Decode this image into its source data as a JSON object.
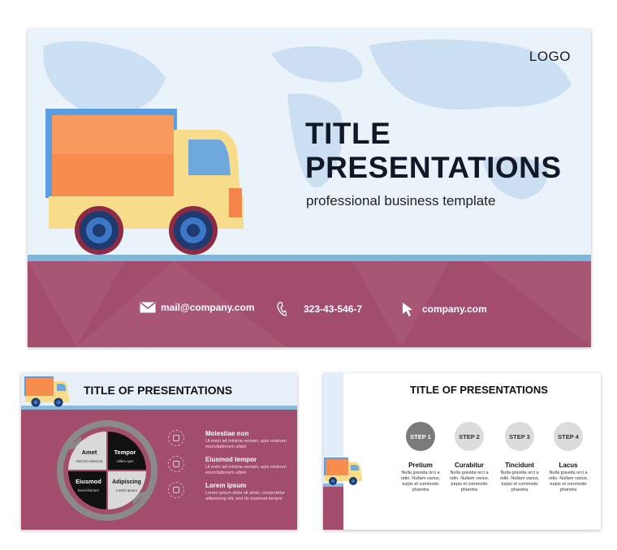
{
  "colors": {
    "band": "#a34d6c",
    "sky": "#eaf2fa",
    "strip": "#7fb6dc",
    "truck_cargo": "#f68c4d",
    "truck_cab": "#f7dc8c",
    "truck_window": "#6fa8dc",
    "wheel": "#1e3a6e"
  },
  "main_slide": {
    "logo": "LOGO",
    "title_line1": "TITLE",
    "title_line2": "PRESENTATIONS",
    "subtitle": "professional business template",
    "contacts": {
      "email": "mail@company.com",
      "phone": "323-43-546-7",
      "website": "company.com"
    }
  },
  "slide_cycle": {
    "title": "TITLE OF PRESENTATIONS",
    "cycle": [
      {
        "label": "Amet",
        "sub": "Sed do eiusmod"
      },
      {
        "label": "Tempor",
        "sub": "Ullam quis"
      },
      {
        "label": "Adipiscing",
        "sub": "Lorem ipsum"
      },
      {
        "label": "Eiusmod",
        "sub": "Exercitionem"
      }
    ],
    "items": [
      {
        "heading": "Molestiae non",
        "body": "Ut enim ad minima veniam, quis nostrum exercitationem ullam"
      },
      {
        "heading": "Eiusmod tempor",
        "body": "Ut enim ad minima veniam, quis nostrum exercitationem ullam"
      },
      {
        "heading": "Lorem ipsum",
        "body": "Lorem ipsum dolor sit amet, consectetur adipisicing elit, sed do eiusmod tempor"
      }
    ]
  },
  "slide_steps": {
    "title": "TITLE OF PRESENTATIONS",
    "steps": [
      {
        "label": "STEP 1",
        "name": "Pretium",
        "desc": "Nulla gravida orci a odio. Nullam varius, turpis et commodo pharetra"
      },
      {
        "label": "STEP 2",
        "name": "Curabitur",
        "desc": "Nulla gravida orci a odio. Nullam varius, turpis et commodo pharetra"
      },
      {
        "label": "STEP 3",
        "name": "Tincidunt",
        "desc": "Nulla gravida orci a odio. Nullam varius, turpis et commodo pharetra"
      },
      {
        "label": "STEP 4",
        "name": "Lacus",
        "desc": "Nulla gravida orci a odio. Nullam varius, turpis et commodo pharetra"
      }
    ]
  }
}
